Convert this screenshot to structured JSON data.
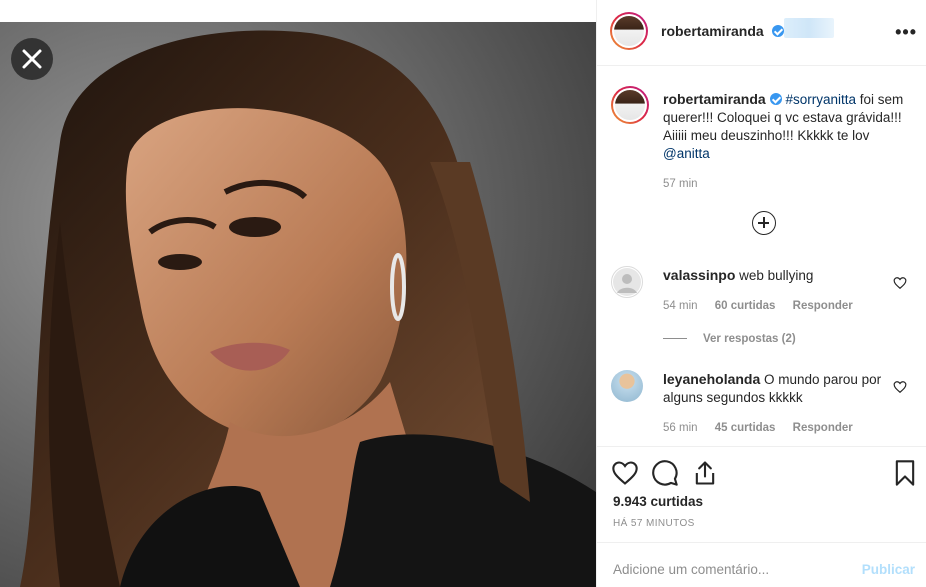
{
  "post": {
    "username": "robertamiranda",
    "caption_prefix": "#sorryanitta",
    "caption_body": " foi sem querer!!! Coloquei q vc estava grávida!!! Aiiiii meu deuszinho!!! Kkkkk te lov ",
    "caption_mention": "@anitta",
    "caption_time": "57 min",
    "likes": "9.943 curtidas",
    "posted_ago": "HÁ 57 MINUTOS"
  },
  "comments": [
    {
      "username": "valassinpo",
      "text": "web bullying",
      "time": "54 min",
      "likes": "60 curtidas",
      "reply": "Responder"
    },
    {
      "username": "leyaneholanda",
      "text": "O mundo parou por alguns segundos kkkkk",
      "time": "56 min",
      "likes": "45 curtidas",
      "reply": "Responder"
    }
  ],
  "view_replies": "Ver respostas (2)",
  "add_comment": {
    "placeholder": "Adicione um comentário...",
    "publish": "Publicar"
  },
  "icons": {
    "close": "close-icon",
    "more": "more-options-icon",
    "like": "heart-icon",
    "comment": "comment-icon",
    "share": "share-icon",
    "save": "bookmark-icon",
    "load_more": "plus-circle-icon"
  },
  "colors": {
    "link": "#003569",
    "verified": "#3897f0",
    "muted": "#8e8e8e",
    "publish_disabled": "#b2dffc"
  }
}
